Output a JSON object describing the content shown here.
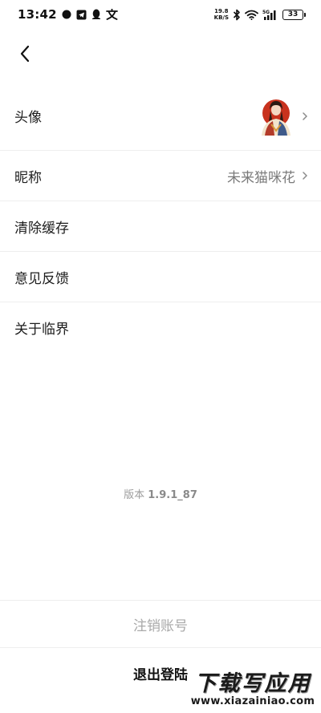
{
  "status_bar": {
    "time": "13:42",
    "net_speed_value": "19.8",
    "net_speed_unit": "KB/S",
    "signal_label": "5G",
    "battery": "33"
  },
  "settings": {
    "rows": [
      {
        "label": "头像"
      },
      {
        "label": "昵称",
        "value": "未来猫咪花"
      },
      {
        "label": "清除缓存"
      },
      {
        "label": "意见反馈"
      },
      {
        "label": "关于临界"
      }
    ]
  },
  "version": {
    "prefix": "版本",
    "number": "1.9.1_87"
  },
  "buttons": {
    "cancel_account": "注销账号",
    "logout": "退出登陆"
  },
  "watermark": {
    "title": "下载写应用",
    "url": "www.xiazainiao.com"
  },
  "icons": {
    "back": "chevron-left-icon",
    "row_arrow": "chevron-right-icon"
  }
}
